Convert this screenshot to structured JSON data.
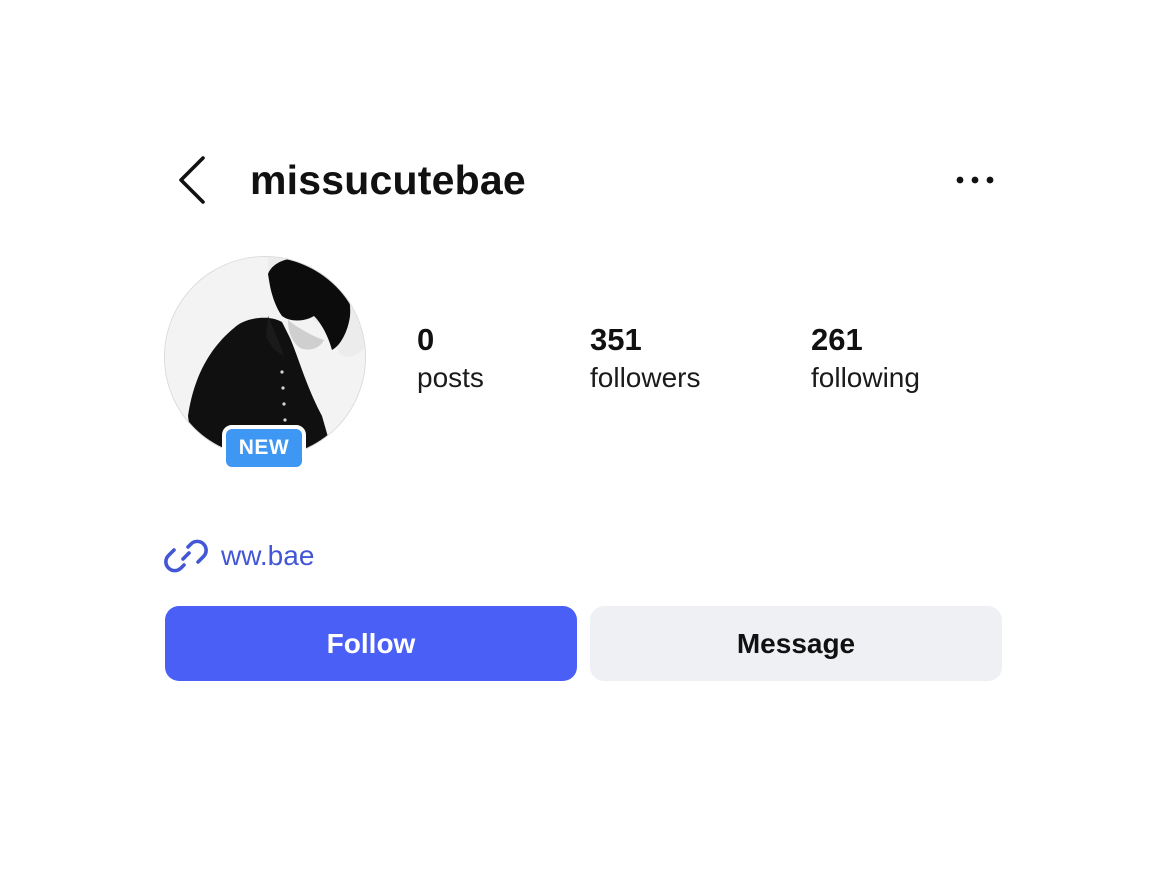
{
  "header": {
    "username": "missucutebae",
    "back_icon": "chevron-left-icon",
    "more_icon": "more-horizontal-icon"
  },
  "profile": {
    "avatar_description_icon": "profile-photo",
    "badge": "NEW",
    "badge_color": "#3e97f2"
  },
  "stats": {
    "posts": {
      "value": "0",
      "label": "posts"
    },
    "followers": {
      "value": "351",
      "label": "followers"
    },
    "following": {
      "value": "261",
      "label": "following"
    }
  },
  "link": {
    "icon": "link-icon",
    "text": "ww.bae",
    "color": "#4356d6"
  },
  "actions": {
    "follow_label": "Follow",
    "message_label": "Message",
    "follow_color": "#4a5ff6",
    "message_color": "#eef0f4"
  }
}
